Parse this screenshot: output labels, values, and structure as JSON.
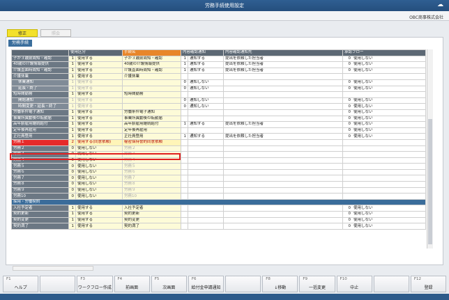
{
  "window": {
    "title": "労務手続使用設定",
    "brand": "OBC商事株式会社"
  },
  "mode": {
    "active": "修正",
    "inactive": "照会"
  },
  "tab": "労務手続",
  "columns": [
    "",
    "使用区分",
    "",
    "手続名",
    "内容確認通知",
    "",
    "内容確認通知先",
    "",
    "承認フロー"
  ],
  "rows": [
    {
      "label": "子が３歳前周知・確認",
      "c1": "1",
      "c2": "使用する",
      "name": "子が３歳前周知・確認",
      "n1": "1",
      "n2": "通知する",
      "dest": "提出を依頼した担当者",
      "f1": "0",
      "f2": "使用しない"
    },
    {
      "label": "40歳の介護情報提供",
      "c1": "1",
      "c2": "使用する",
      "name": "40歳の介護情報提供",
      "n1": "1",
      "n2": "通知する",
      "dest": "提出を依頼した担当者",
      "f1": "0",
      "f2": "使用しない"
    },
    {
      "label": "介護直面時周知・確認",
      "c1": "1",
      "c2": "使用する",
      "name": "介護直面時周知・確認",
      "n1": "1",
      "n2": "通知する",
      "dest": "提出を依頼した担当者",
      "f1": "0",
      "f2": "使用しない"
    },
    {
      "label": "介護休業",
      "c1": "1",
      "c2": "使用する",
      "name": "介護休業",
      "n1": "",
      "n2": "",
      "dest": "",
      "f1": "",
      "f2": ""
    },
    {
      "label": "休業通知",
      "sub": true,
      "c1": "1",
      "c2": "使用する",
      "dis": true,
      "name": "",
      "n1": "0",
      "n2": "通知しない",
      "dest": "",
      "f1": "0",
      "f2": "使用しない"
    },
    {
      "label": "延長・終了",
      "sub": true,
      "c1": "1",
      "c2": "使用する",
      "dis": true,
      "name": "",
      "n1": "0",
      "n2": "通知しない",
      "dest": "",
      "f1": "0",
      "f2": "使用しない"
    },
    {
      "label": "短時間勤務",
      "c1": "1",
      "c2": "使用する",
      "name": "短時間勤務",
      "n1": "",
      "n2": "",
      "dest": "",
      "f1": "",
      "f2": ""
    },
    {
      "label": "開始通知",
      "sub": true,
      "c1": "1",
      "c2": "使用する",
      "dis": true,
      "name": "",
      "n1": "0",
      "n2": "通知しない",
      "dest": "",
      "f1": "0",
      "f2": "使用しない"
    },
    {
      "label": "時間変更・延長・終了",
      "sub": true,
      "c1": "1",
      "c2": "使用する",
      "dis": true,
      "name": "",
      "n1": "0",
      "n2": "通知しない",
      "dest": "",
      "f1": "0",
      "f2": "使用しない"
    },
    {
      "label": "労働条件電子通知",
      "c1": "1",
      "c2": "使用する",
      "name": "労働条件電子通知",
      "n1": "",
      "n2": "",
      "dest": "",
      "f1": "0",
      "f2": "使用しない"
    },
    {
      "label": "事業所異動後の転勤届",
      "c1": "1",
      "c2": "使用する",
      "name": "事業所異動後の転勤届",
      "n1": "",
      "n2": "",
      "dest": "",
      "f1": "0",
      "f2": "使用しない"
    },
    {
      "label": "高年齢雇用継続給付",
      "c1": "1",
      "c2": "使用する",
      "name": "高年齢雇用継続給付",
      "n1": "1",
      "n2": "通知する",
      "dest": "提出を依頼した担当者",
      "f1": "0",
      "f2": "使用しない"
    },
    {
      "label": "定年後再雇用",
      "c1": "1",
      "c2": "使用する",
      "name": "定年後再雇用",
      "n1": "",
      "n2": "",
      "dest": "",
      "f1": "0",
      "f2": "使用しない"
    },
    {
      "label": "正社員登用",
      "c1": "1",
      "c2": "使用する",
      "name": "正社員登用",
      "n1": "1",
      "n2": "通知する",
      "dest": "提出を依頼した担当者",
      "f1": "0",
      "f2": "使用しない"
    },
    {
      "label": "労務１",
      "sel": true,
      "c1": "2",
      "c2": "使用する(同意依頼)",
      "name": "秘密保持誓約同意依頼",
      "n1": "",
      "n2": "",
      "dest": "",
      "f1": "",
      "f2": ""
    },
    {
      "label": "労務２",
      "c1": "0",
      "c2": "使用しない",
      "name": "労務２",
      "dim": true,
      "n1": "",
      "n2": "",
      "dest": "",
      "f1": "",
      "f2": ""
    },
    {
      "label": "労務３",
      "c1": "0",
      "c2": "使用しない",
      "name": "労務３",
      "dim": true,
      "n1": "",
      "n2": "",
      "dest": "",
      "f1": "",
      "f2": ""
    },
    {
      "label": "労務４",
      "c1": "0",
      "c2": "使用しない",
      "name": "労務４",
      "dim": true,
      "n1": "",
      "n2": "",
      "dest": "",
      "f1": "",
      "f2": ""
    },
    {
      "label": "労務５",
      "c1": "0",
      "c2": "使用しない",
      "name": "労務５",
      "dim": true,
      "n1": "",
      "n2": "",
      "dest": "",
      "f1": "",
      "f2": ""
    },
    {
      "label": "労務６",
      "c1": "0",
      "c2": "使用しない",
      "name": "労務６",
      "dim": true,
      "n1": "",
      "n2": "",
      "dest": "",
      "f1": "",
      "f2": ""
    },
    {
      "label": "労務７",
      "c1": "0",
      "c2": "使用しない",
      "name": "労務７",
      "dim": true,
      "n1": "",
      "n2": "",
      "dest": "",
      "f1": "",
      "f2": ""
    },
    {
      "label": "労務８",
      "c1": "0",
      "c2": "使用しない",
      "name": "労務８",
      "dim": true,
      "n1": "",
      "n2": "",
      "dest": "",
      "f1": "",
      "f2": ""
    },
    {
      "label": "労務９",
      "c1": "0",
      "c2": "使用しない",
      "name": "労務９",
      "dim": true,
      "n1": "",
      "n2": "",
      "dest": "",
      "f1": "",
      "f2": ""
    },
    {
      "label": "労務10",
      "c1": "0",
      "c2": "使用しない",
      "name": "労務10",
      "dim": true,
      "n1": "",
      "n2": "",
      "dest": "",
      "f1": "",
      "f2": ""
    },
    {
      "section": true,
      "label": "採用・労働契約"
    },
    {
      "label": "入社予定者",
      "c1": "1",
      "c2": "使用する",
      "name": "入社予定者",
      "n1": "",
      "n2": "",
      "dest": "",
      "f1": "0",
      "f2": "使用しない"
    },
    {
      "label": "契約更新",
      "c1": "1",
      "c2": "使用する",
      "name": "契約更新",
      "n1": "",
      "n2": "",
      "dest": "",
      "f1": "0",
      "f2": "使用しない"
    },
    {
      "label": "契約変更",
      "c1": "1",
      "c2": "使用する",
      "name": "契約変更",
      "n1": "",
      "n2": "",
      "dest": "",
      "f1": "0",
      "f2": "使用しない"
    },
    {
      "label": "契約満了",
      "c1": "1",
      "c2": "使用する",
      "name": "契約満了",
      "n1": "",
      "n2": "",
      "dest": "",
      "f1": "0",
      "f2": "使用しない"
    }
  ],
  "fkeys": [
    {
      "key": "F1",
      "label": "ヘルプ"
    },
    {
      "key": "",
      "label": ""
    },
    {
      "key": "F3",
      "label": "ワークフロー作成"
    },
    {
      "key": "F4",
      "label": "前画面"
    },
    {
      "key": "F5",
      "label": "次画面"
    },
    {
      "key": "F6",
      "label": "給付金申請通知"
    },
    {
      "key": "",
      "label": ""
    },
    {
      "key": "F8",
      "label": "↓移動"
    },
    {
      "key": "F9",
      "label": "一括変更"
    },
    {
      "key": "F10",
      "label": "中止"
    },
    {
      "key": "",
      "label": ""
    },
    {
      "key": "F12",
      "label": "登録"
    }
  ]
}
